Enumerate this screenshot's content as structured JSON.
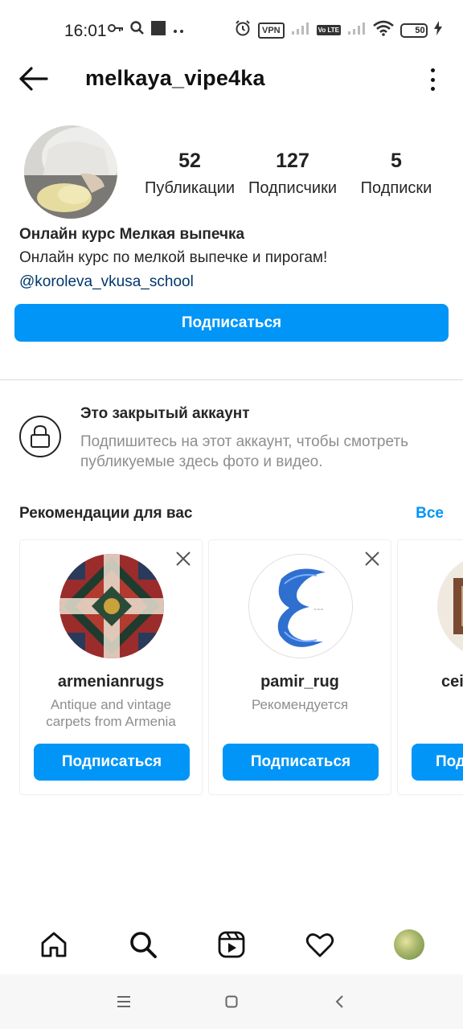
{
  "status_bar": {
    "time": "16:01",
    "vpn": "VPN",
    "volte": "Vo LTE",
    "battery": "50"
  },
  "header": {
    "username": "melkaya_vipe4ka",
    "back_icon": "arrow-left-icon",
    "more_icon": "more-vertical-icon"
  },
  "profile": {
    "stats": [
      {
        "value": "52",
        "label": "Публикации"
      },
      {
        "value": "127",
        "label": "Подписчики"
      },
      {
        "value": "5",
        "label": "Подписки"
      }
    ],
    "bio_name": "Онлайн курс Мелкая выпечка",
    "bio_text": "Онлайн курс по мелкой выпечке и пирогам!",
    "bio_link": "@koroleva_vkusa_school",
    "follow_label": "Подписаться"
  },
  "private": {
    "title": "Это закрытый аккаунт",
    "description": "Подпишитесь на этот аккаунт, чтобы смотреть публикуемые здесь фото и видео."
  },
  "recommendations": {
    "title": "Рекомендации для вас",
    "see_all": "Все",
    "cards": [
      {
        "name": "armenianrugs",
        "subtitle": "Antique and vintage carpets from Armenia",
        "button": "Подписаться"
      },
      {
        "name": "pamir_rug",
        "subtitle": "Рекомендуется",
        "button": "Подписаться"
      },
      {
        "name": "cei",
        "subtitle": "",
        "button": "Под"
      }
    ]
  },
  "bottom_nav": {
    "items": [
      "home-icon",
      "search-icon",
      "reels-icon",
      "heart-icon",
      "profile-avatar"
    ]
  },
  "colors": {
    "accent": "#0095f6",
    "link": "#00376b",
    "muted": "#8e8e8e"
  }
}
